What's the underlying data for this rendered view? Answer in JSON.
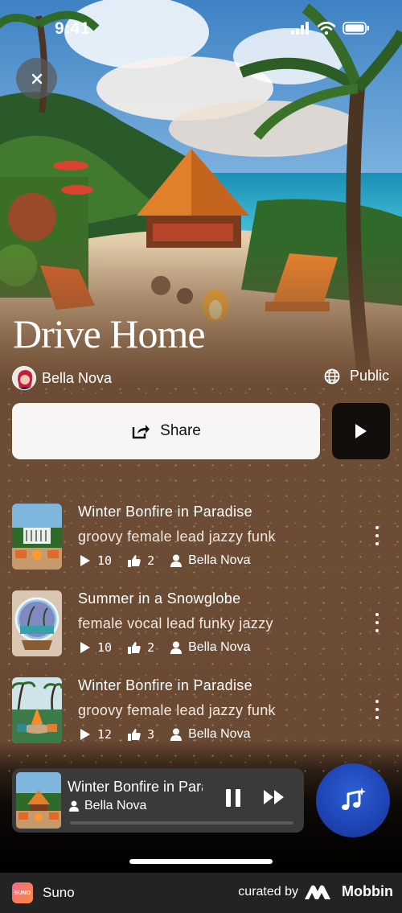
{
  "status_bar": {
    "time": "9:41"
  },
  "playlist": {
    "title": "Drive Home",
    "author": "Bella Nova",
    "visibility": "Public",
    "share_label": "Share"
  },
  "songs": [
    {
      "title": "Winter Bonfire in Paradise",
      "description": "groovy female lead jazzy funk",
      "plays": "10",
      "likes": "2",
      "artist": "Bella Nova"
    },
    {
      "title": "Summer in a Snowglobe",
      "description": "female vocal lead funky jazzy",
      "plays": "10",
      "likes": "2",
      "artist": "Bella Nova"
    },
    {
      "title": "Winter Bonfire in Paradise",
      "description": "groovy female lead jazzy funk",
      "plays": "12",
      "likes": "3",
      "artist": "Bella Nova"
    }
  ],
  "now_playing": {
    "title": "Winter Bonfire in Paradise",
    "artist": "Bella Nova",
    "progress": 0.0
  },
  "footer": {
    "app_name": "Suno",
    "app_logo_text": "SUNO",
    "curated_by": "curated by",
    "brand": "Mobbin"
  },
  "icons": {
    "close": "close-icon",
    "globe": "globe-icon",
    "share": "share-icon",
    "play": "play-icon",
    "like": "thumbs-up-icon",
    "person": "person-icon",
    "more": "more-vertical-icon",
    "pause": "pause-icon",
    "fast_forward": "fast-forward-icon",
    "create": "music-note-sparkle-icon"
  },
  "colors": {
    "background": "#6b4b33",
    "create_button": "#1e44b3",
    "mini_player": "#3a3a3a"
  }
}
